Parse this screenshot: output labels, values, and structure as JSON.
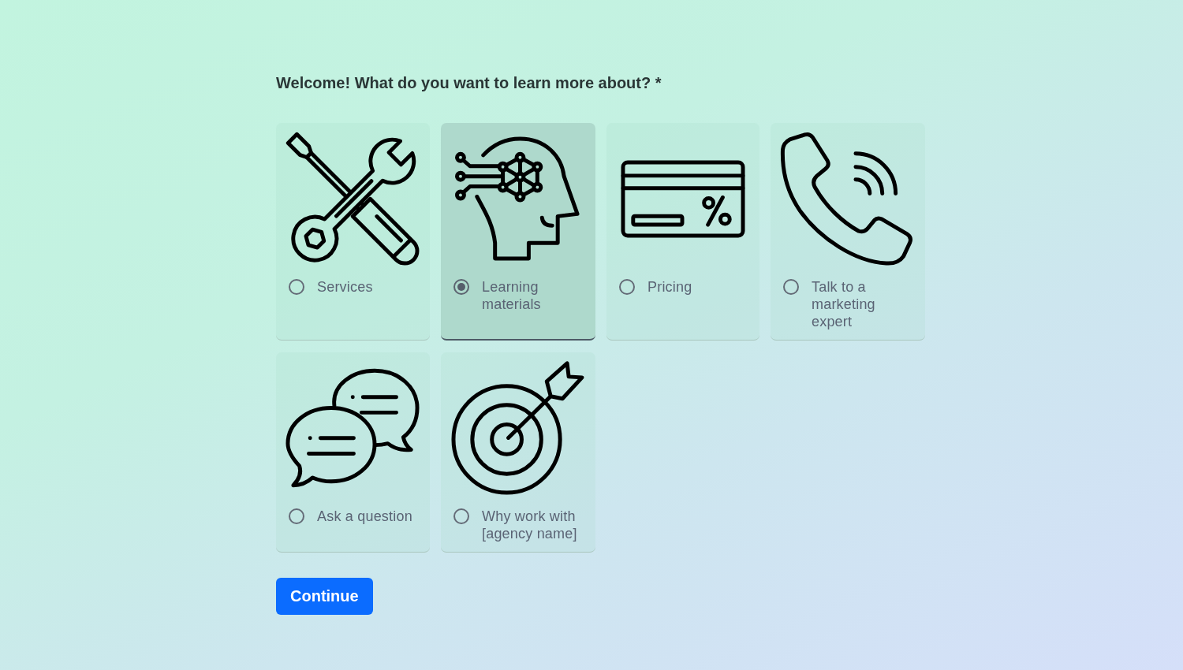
{
  "question": "Welcome! What do you want to learn more about? *",
  "options": [
    {
      "label": "Services",
      "selected": false
    },
    {
      "label": "Learning materials",
      "selected": true
    },
    {
      "label": "Pricing",
      "selected": false
    },
    {
      "label": "Talk to a marketing expert",
      "selected": false
    },
    {
      "label": "Ask a question",
      "selected": false
    },
    {
      "label": "Why work with [agency name]",
      "selected": false
    }
  ],
  "continue_button": "Continue"
}
